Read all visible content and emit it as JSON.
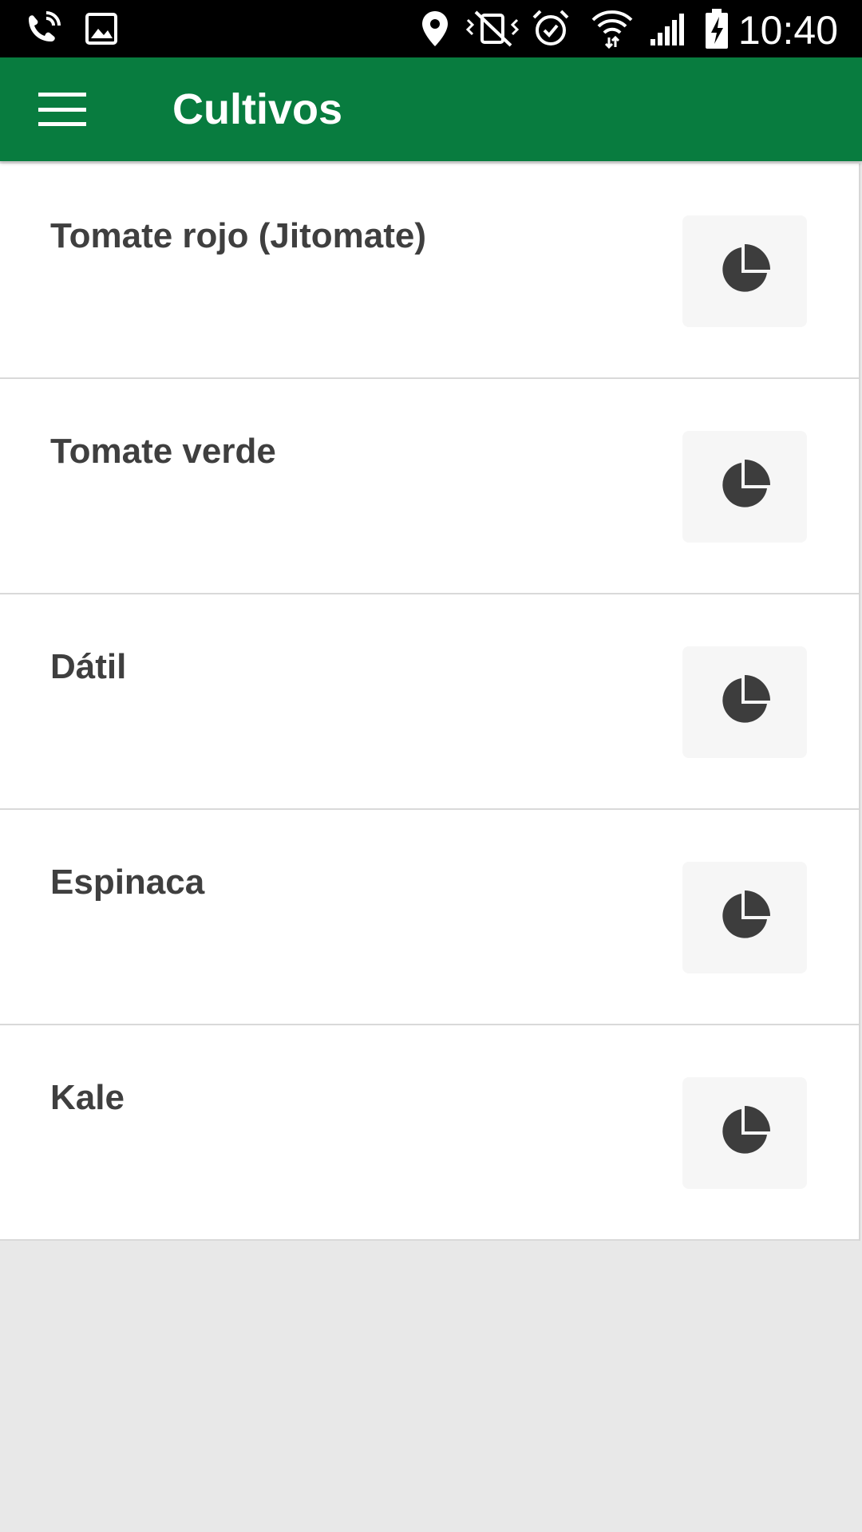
{
  "status_bar": {
    "time": "10:40",
    "icons": [
      "wifi-call-icon",
      "gallery-icon",
      "location-icon",
      "vibrate-off-icon",
      "alarm-icon",
      "wifi-icon",
      "signal-icon",
      "battery-charging-icon"
    ]
  },
  "app_bar": {
    "title": "Cultivos",
    "menu_icon": "hamburger-menu-icon",
    "background_color": "#087c3f"
  },
  "crops": [
    {
      "name": "Tomate rojo (Jitomate)",
      "action_icon": "pie-chart-icon"
    },
    {
      "name": "Tomate verde",
      "action_icon": "pie-chart-icon"
    },
    {
      "name": "Dátil",
      "action_icon": "pie-chart-icon"
    },
    {
      "name": "Espinaca",
      "action_icon": "pie-chart-icon"
    },
    {
      "name": "Kale",
      "action_icon": "pie-chart-icon"
    }
  ]
}
